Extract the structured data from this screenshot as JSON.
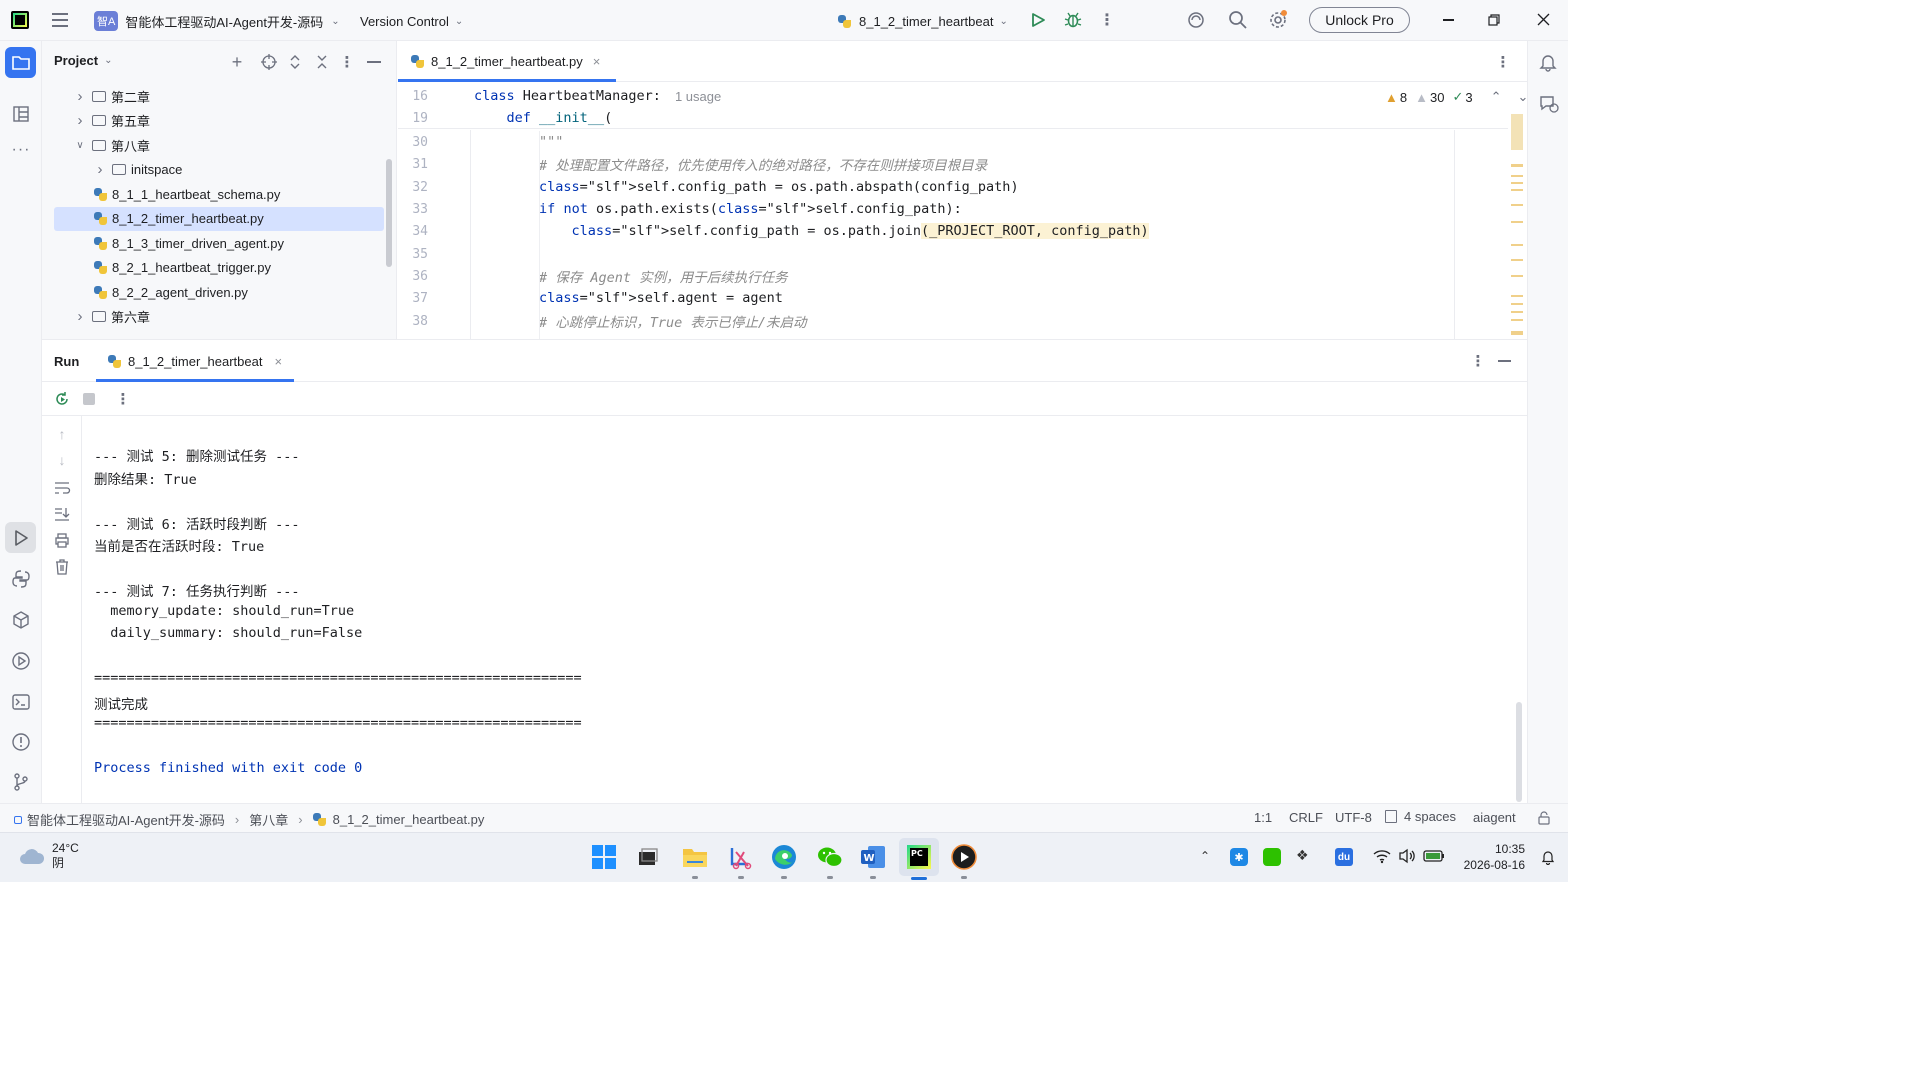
{
  "titlebar": {
    "project_badge": "智A",
    "project_name": "智能体工程驱动AI-Agent开发-源码",
    "vcs": "Version Control",
    "run_config": "8_1_2_timer_heartbeat",
    "unlock": "Unlock Pro"
  },
  "project_panel": {
    "title": "Project",
    "items": [
      {
        "label": "第二章",
        "kind": "folder",
        "expanded": false
      },
      {
        "label": "第五章",
        "kind": "folder",
        "expanded": false
      },
      {
        "label": "第八章",
        "kind": "folder",
        "expanded": true
      },
      {
        "label": "initspace",
        "kind": "folder",
        "expanded": false
      },
      {
        "label": "8_1_1_heartbeat_schema.py",
        "kind": "py"
      },
      {
        "label": "8_1_2_timer_heartbeat.py",
        "kind": "py",
        "selected": true
      },
      {
        "label": "8_1_3_timer_driven_agent.py",
        "kind": "py"
      },
      {
        "label": "8_2_1_heartbeat_trigger.py",
        "kind": "py"
      },
      {
        "label": "8_2_2_agent_driven.py",
        "kind": "py"
      },
      {
        "label": "第六章",
        "kind": "folder",
        "expanded": false
      }
    ]
  },
  "editor": {
    "tab": "8_1_2_timer_heartbeat.py",
    "warn1": "8",
    "warn2": "30",
    "ok": "3",
    "usage": "1 usage",
    "lines": [
      {
        "n": "16",
        "code": "class HeartbeatManager:"
      },
      {
        "n": "19",
        "code": "    def __init__("
      },
      {
        "n": "30",
        "code": "        \"\"\""
      },
      {
        "n": "31",
        "code": "        # 处理配置文件路径，优先使用传入的绝对路径，不存在则拼接项目根目录"
      },
      {
        "n": "32",
        "code": "        self.config_path = os.path.abspath(config_path)"
      },
      {
        "n": "33",
        "code": "        if not os.path.exists(self.config_path):"
      },
      {
        "n": "34",
        "code": "            self.config_path = os.path.join(_PROJECT_ROOT, config_path)"
      },
      {
        "n": "35",
        "code": ""
      },
      {
        "n": "36",
        "code": "        # 保存 Agent 实例，用于后续执行任务"
      },
      {
        "n": "37",
        "code": "        self.agent = agent"
      },
      {
        "n": "38",
        "code": "        # 心跳停止标识，True 表示已停止/未启动"
      }
    ]
  },
  "run_panel": {
    "title": "Run",
    "tab": "8_1_2_timer_heartbeat",
    "output": [
      "--- 测试 5: 删除测试任务 ---",
      "删除结果: True",
      "",
      "--- 测试 6: 活跃时段判断 ---",
      "当前是否在活跃时段: True",
      "",
      "--- 测试 7: 任务执行判断 ---",
      "  memory_update: should_run=True",
      "  daily_summary: should_run=False",
      "",
      "============================================================",
      "测试完成",
      "============================================================",
      "",
      "Process finished with exit code 0"
    ]
  },
  "statusbar": {
    "crumb_project": "智能体工程驱动AI-Agent开发-源码",
    "crumb_folder": "第八章",
    "crumb_file": "8_1_2_timer_heartbeat.py",
    "position": "1:1",
    "line_sep": "CRLF",
    "encoding": "UTF-8",
    "indent": "4 spaces",
    "interpreter": "aiagent"
  },
  "taskbar": {
    "temperature": "24°C",
    "weather": "阴",
    "time": "10:35",
    "date": "2026-08-16"
  },
  "colors": {
    "accent": "#3574f0",
    "selection": "#d5e1ff",
    "keyword": "#0033b3",
    "self": "#94558d",
    "comment": "#8c8c8c",
    "run_green": "#2e8b57",
    "process_text": "#0033b3"
  }
}
